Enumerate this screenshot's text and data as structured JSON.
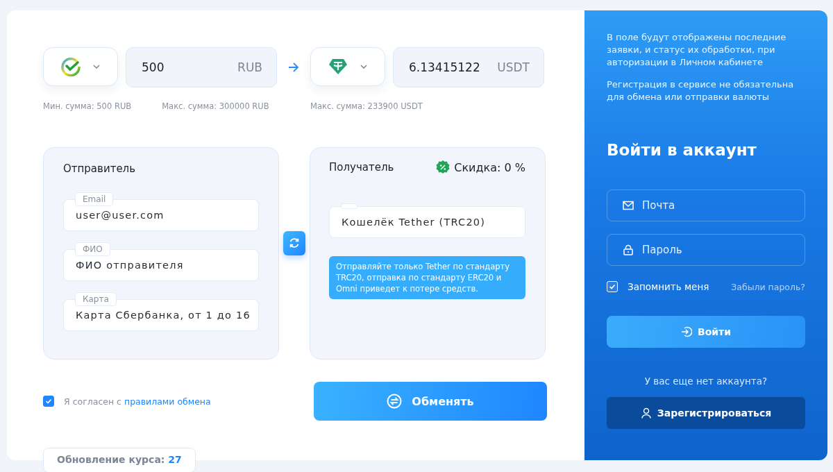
{
  "exchange": {
    "from": {
      "amount": "500",
      "currency": "RUB",
      "hints": [
        "Мин. сумма: 500 RUB",
        "Макс. сумма: 300000 RUB"
      ]
    },
    "to": {
      "amount": "6.13415122",
      "currency": "USDT",
      "hints": [
        "Макс. сумма: 233900 USDT"
      ]
    }
  },
  "sender": {
    "title": "Отправитель",
    "fields": [
      {
        "label": "Email",
        "value": "user@user.com"
      },
      {
        "label": "ФИО",
        "value": "ФИО отправителя"
      },
      {
        "label": "Карта",
        "value": "Карта Сбербанка, от 1 до 16"
      }
    ]
  },
  "receiver": {
    "title": "Получатель",
    "discount": "Скидка: 0 %",
    "field": {
      "value": "Кошелёк Tether (TRC20)"
    },
    "notice": "Отправляйте только Tether по стандарту TRC20, отправка по стандарту ERC20 и Omni приведет к потере средств."
  },
  "agreement": {
    "checked": true,
    "text": "Я согласен с ",
    "link": "правилами обмена"
  },
  "exchange_button": "Обменять",
  "rate_update": {
    "label": "Обновление курса: ",
    "value": "27"
  },
  "side": {
    "info": [
      "В поле будут отображены последние заявки, и статус их обработки, при авторизации в Личном кабинете",
      "Регистрация в сервисе не обязательна для обмена или отправки валюты"
    ],
    "title": "Войти в аккаунт",
    "fields": [
      {
        "kind": "email",
        "placeholder": "Почта"
      },
      {
        "kind": "password",
        "placeholder": "Пароль"
      }
    ],
    "remember": {
      "checked": true,
      "label": "Запомнить меня"
    },
    "forgot": "Забыли пароль?",
    "login_button": "Войти",
    "no_account": "У вас еще нет аккаунта?",
    "register_button": "Зарегистрироваться"
  }
}
